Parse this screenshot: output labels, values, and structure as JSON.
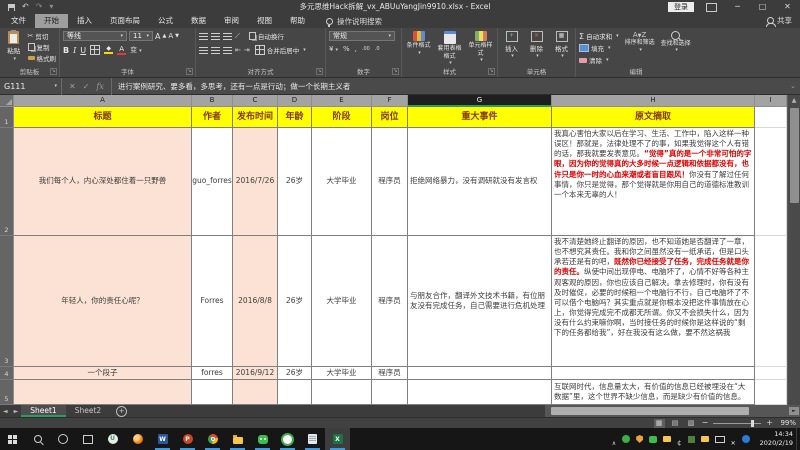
{
  "window": {
    "title": "多元思维Hack拆解_vx_ABUuYangJin9910.xlsx  -  Excel",
    "sign_in": "登录",
    "share": "共享"
  },
  "ribbon": {
    "tabs": [
      "文件",
      "开始",
      "插入",
      "页面布局",
      "公式",
      "数据",
      "审阅",
      "视图",
      "帮助"
    ],
    "active_tab": "开始",
    "search": "操作说明搜索",
    "clipboard": {
      "paste": "粘贴",
      "cut": "剪切",
      "copy": "复制",
      "painter": "格式刷",
      "label": "剪贴板"
    },
    "font": {
      "name": "等线",
      "size": "11",
      "bold": "B",
      "italic": "I",
      "underline": "U",
      "label": "字体"
    },
    "alignment": {
      "wrap": "自动换行",
      "merge": "合并后居中",
      "label": "对齐方式"
    },
    "number": {
      "format": "常规",
      "label": "数字"
    },
    "styles": {
      "conditional": "条件格式",
      "table": "套用表格格式",
      "cell": "单元格样式",
      "label": "样式"
    },
    "cells": {
      "insert": "插入",
      "del": "删除",
      "format": "格式",
      "label": "单元格"
    },
    "editing": {
      "autosum": "自动求和",
      "fill": "填充",
      "clear": "清除",
      "sort": "排序和筛选",
      "find": "查找和选择",
      "label": "编辑"
    }
  },
  "formula_bar": {
    "name_box": "G111",
    "content": "进行案例研究、要多看，多思考，还有一点是行动；做一个长期主义者"
  },
  "grid": {
    "col_letters": [
      "A",
      "B",
      "C",
      "D",
      "E",
      "F",
      "G",
      "H",
      "I"
    ],
    "selected_col": "G",
    "rows": [
      {
        "num": "1",
        "cells": {
          "a": "标题",
          "b": "作者",
          "c": "发布时间",
          "d": "年龄",
          "e": "阶段",
          "f": "岗位",
          "g": "重大事件",
          "h": "原文摘取"
        }
      },
      {
        "num": "2",
        "cells": {
          "a": "我们每个人，内心深处都住着一只野兽",
          "b": "guo_forres",
          "c": "2016/7/26",
          "d": "26岁",
          "e": "大学毕业",
          "f": "程序员",
          "g": "拒绝网络暴力，没有调研就没有发言权",
          "h": [
            {
              "t": "我真心害怕大家以后在学习、生活、工作中，陷入这样一种误区！那就是，法律处理不了的事，如果我觉得这个人有错的话，那我就要发表意见。",
              "red": false
            },
            {
              "t": "“觉得”真的是一个非常可怕的字眼，因为你的觉得真的大多时候一点逻辑和依据都没有，也许只是你一时的心血来潮或者盲目跟风！",
              "red": true
            },
            {
              "t": "你没有了解过任何事情，你只是觉得，那个觉得就是你用自己的道德标准教训一个本来无辜的人！",
              "red": false
            }
          ]
        }
      },
      {
        "num": "3",
        "cells": {
          "a": "年轻人，你的责任心呢？",
          "b": "Forres",
          "c": "2016/8/8",
          "d": "26岁",
          "e": "大学毕业",
          "f": "程序员",
          "g": "与朋友合作，翻译外文技术书籍，有位朋友没有完成任务，自己需要进行危机处理",
          "h": [
            {
              "t": "我不清楚她终止翻译的原因，也不知道她是否翻译了一章，也不想究其责任。我和你之间虽然没有一纸承诺，但是口头承若还是有的吧，",
              "red": false
            },
            {
              "t": "既然你已经接受了任务，完成任务就是你的责任。",
              "red": true
            },
            {
              "t": "纵使中间出现停电、电脑坏了，心情不好等各种主观客观的原因，你也应该自己解决。拿去修理时，你有没有及时催促，必要的时候租一个电脑行不行，自己电脑坏了不可以借个电脑吗？其实重点就是你根本没把这件事情放在心上，你觉得完成完不成都无所谓。你又不会损失什么，因为没有什么约束嘛你啊，当时接任务的时候你是这样说的“剩下的任务都给我”，好在我没有这么做，要不然这祸我",
              "red": false
            }
          ]
        }
      },
      {
        "num": "4",
        "cells": {
          "a": "一个段子",
          "b": "forres",
          "c": "2016/9/12",
          "d": "26岁",
          "e": "大学毕业",
          "f": "程序员",
          "g": "",
          "h": ""
        }
      },
      {
        "num": "5",
        "cells": {
          "a": "",
          "b": "",
          "c": "",
          "d": "",
          "e": "",
          "f": "",
          "g": "",
          "h": "互联网时代，信息量太大，有价值的信息已经被埋没在“大数据”里，这个世界不缺少信息，而是缺少有价值的信息。"
        }
      }
    ]
  },
  "sheet_bar": {
    "tabs": [
      {
        "label": "Sheet1",
        "active": true
      },
      {
        "label": "Sheet2",
        "active": false
      }
    ],
    "new_sheet": "+"
  },
  "status_bar": {
    "zoom": "99%"
  },
  "taskbar": {
    "apps": [
      {
        "name": "start",
        "running": false
      },
      {
        "name": "search",
        "running": false
      },
      {
        "name": "cortana",
        "running": false
      },
      {
        "name": "taskview",
        "running": false
      },
      {
        "name": "u",
        "running": false
      },
      {
        "name": "firefox",
        "running": false
      },
      {
        "name": "word",
        "running": true
      },
      {
        "name": "ppt",
        "running": true
      },
      {
        "name": "chrome",
        "running": true
      },
      {
        "name": "explorer",
        "running": true
      },
      {
        "name": "wechat",
        "running": true
      },
      {
        "name": "360",
        "running": true
      },
      {
        "name": "notes",
        "running": true
      },
      {
        "name": "excel",
        "running": true,
        "active": true
      }
    ],
    "tray": [
      "chevron",
      "green",
      "shield",
      "msg",
      "folder",
      "cent",
      "box",
      "folder",
      "usb",
      "x",
      "blue"
    ],
    "time": "14:34",
    "date": "2020/2/19"
  }
}
